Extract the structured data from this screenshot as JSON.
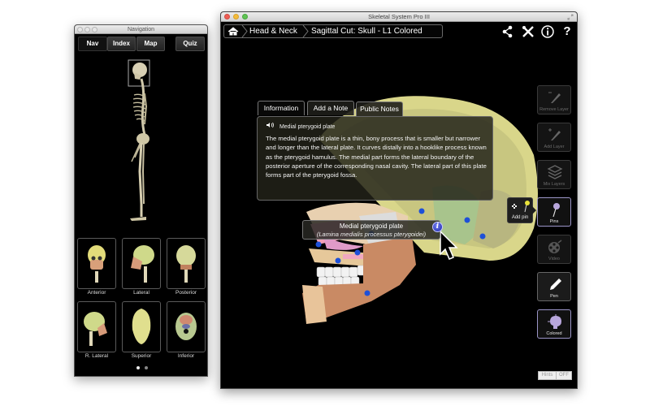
{
  "navigation_window": {
    "title": "Navigation",
    "tabs": [
      {
        "label": "Nav",
        "active": true
      },
      {
        "label": "Index",
        "active": false
      },
      {
        "label": "Map",
        "active": false
      },
      {
        "label": "Quiz",
        "active": false
      }
    ],
    "views": [
      {
        "label": "Anterior"
      },
      {
        "label": "Lateral"
      },
      {
        "label": "Posterior"
      },
      {
        "label": "R. Lateral"
      },
      {
        "label": "Superior"
      },
      {
        "label": "Inferior"
      }
    ],
    "pages": {
      "current": 1,
      "total": 2
    }
  },
  "main_window": {
    "title": "Skeletal System Pro III",
    "breadcrumb": [
      {
        "icon": "home-icon"
      },
      {
        "label": "Head & Neck"
      },
      {
        "label": "Sagittal Cut: Skull - L1 Colored"
      }
    ],
    "top_icons": [
      "share-icon",
      "tools-icon",
      "info-icon",
      "help-icon"
    ],
    "info_panel": {
      "tabs": [
        {
          "label": "Information",
          "active": true
        },
        {
          "label": "Add a Note",
          "active": false
        },
        {
          "label": "Public Notes",
          "active": false
        }
      ],
      "title": "Medial pterygoid plate",
      "body": "The medial pterygoid plate is a thin, bony process that is smaller but narrower and longer than the lateral plate. It curves distally into a hooklike process known as the pterygoid hamulus. The medial part forms the lateral boundary of the posterior aperture of the corresponding nasal cavity. The lateral part of this plate forms part of the pterygoid fossa."
    },
    "pin_label": {
      "name": "Medial pterygoid plate",
      "latin": "(Lamina medialis processus pterygoidei)",
      "info_button": "i"
    },
    "add_pin_tooltip": {
      "label": "Add pin"
    },
    "tools": [
      {
        "label": "Remove Layer",
        "state": "disabled"
      },
      {
        "label": "Add Layer",
        "state": "disabled"
      },
      {
        "label": "Mix Layers",
        "state": "disabled"
      },
      {
        "label": "Pins",
        "state": "selected"
      },
      {
        "label": "Video",
        "state": "disabled"
      },
      {
        "label": "Pen",
        "state": "enabled"
      },
      {
        "label": "Colored",
        "state": "selected"
      }
    ],
    "hints": {
      "label": "Hints",
      "value": "OFF"
    }
  },
  "colors": {
    "skull_yellow": "#d9d68a",
    "skull_green": "#a8c48c",
    "mandible": "#c98a64",
    "pin_blue": "#1e50d8",
    "selected_border": "#9b95c8",
    "colored_icon": "#b8a6dc"
  }
}
